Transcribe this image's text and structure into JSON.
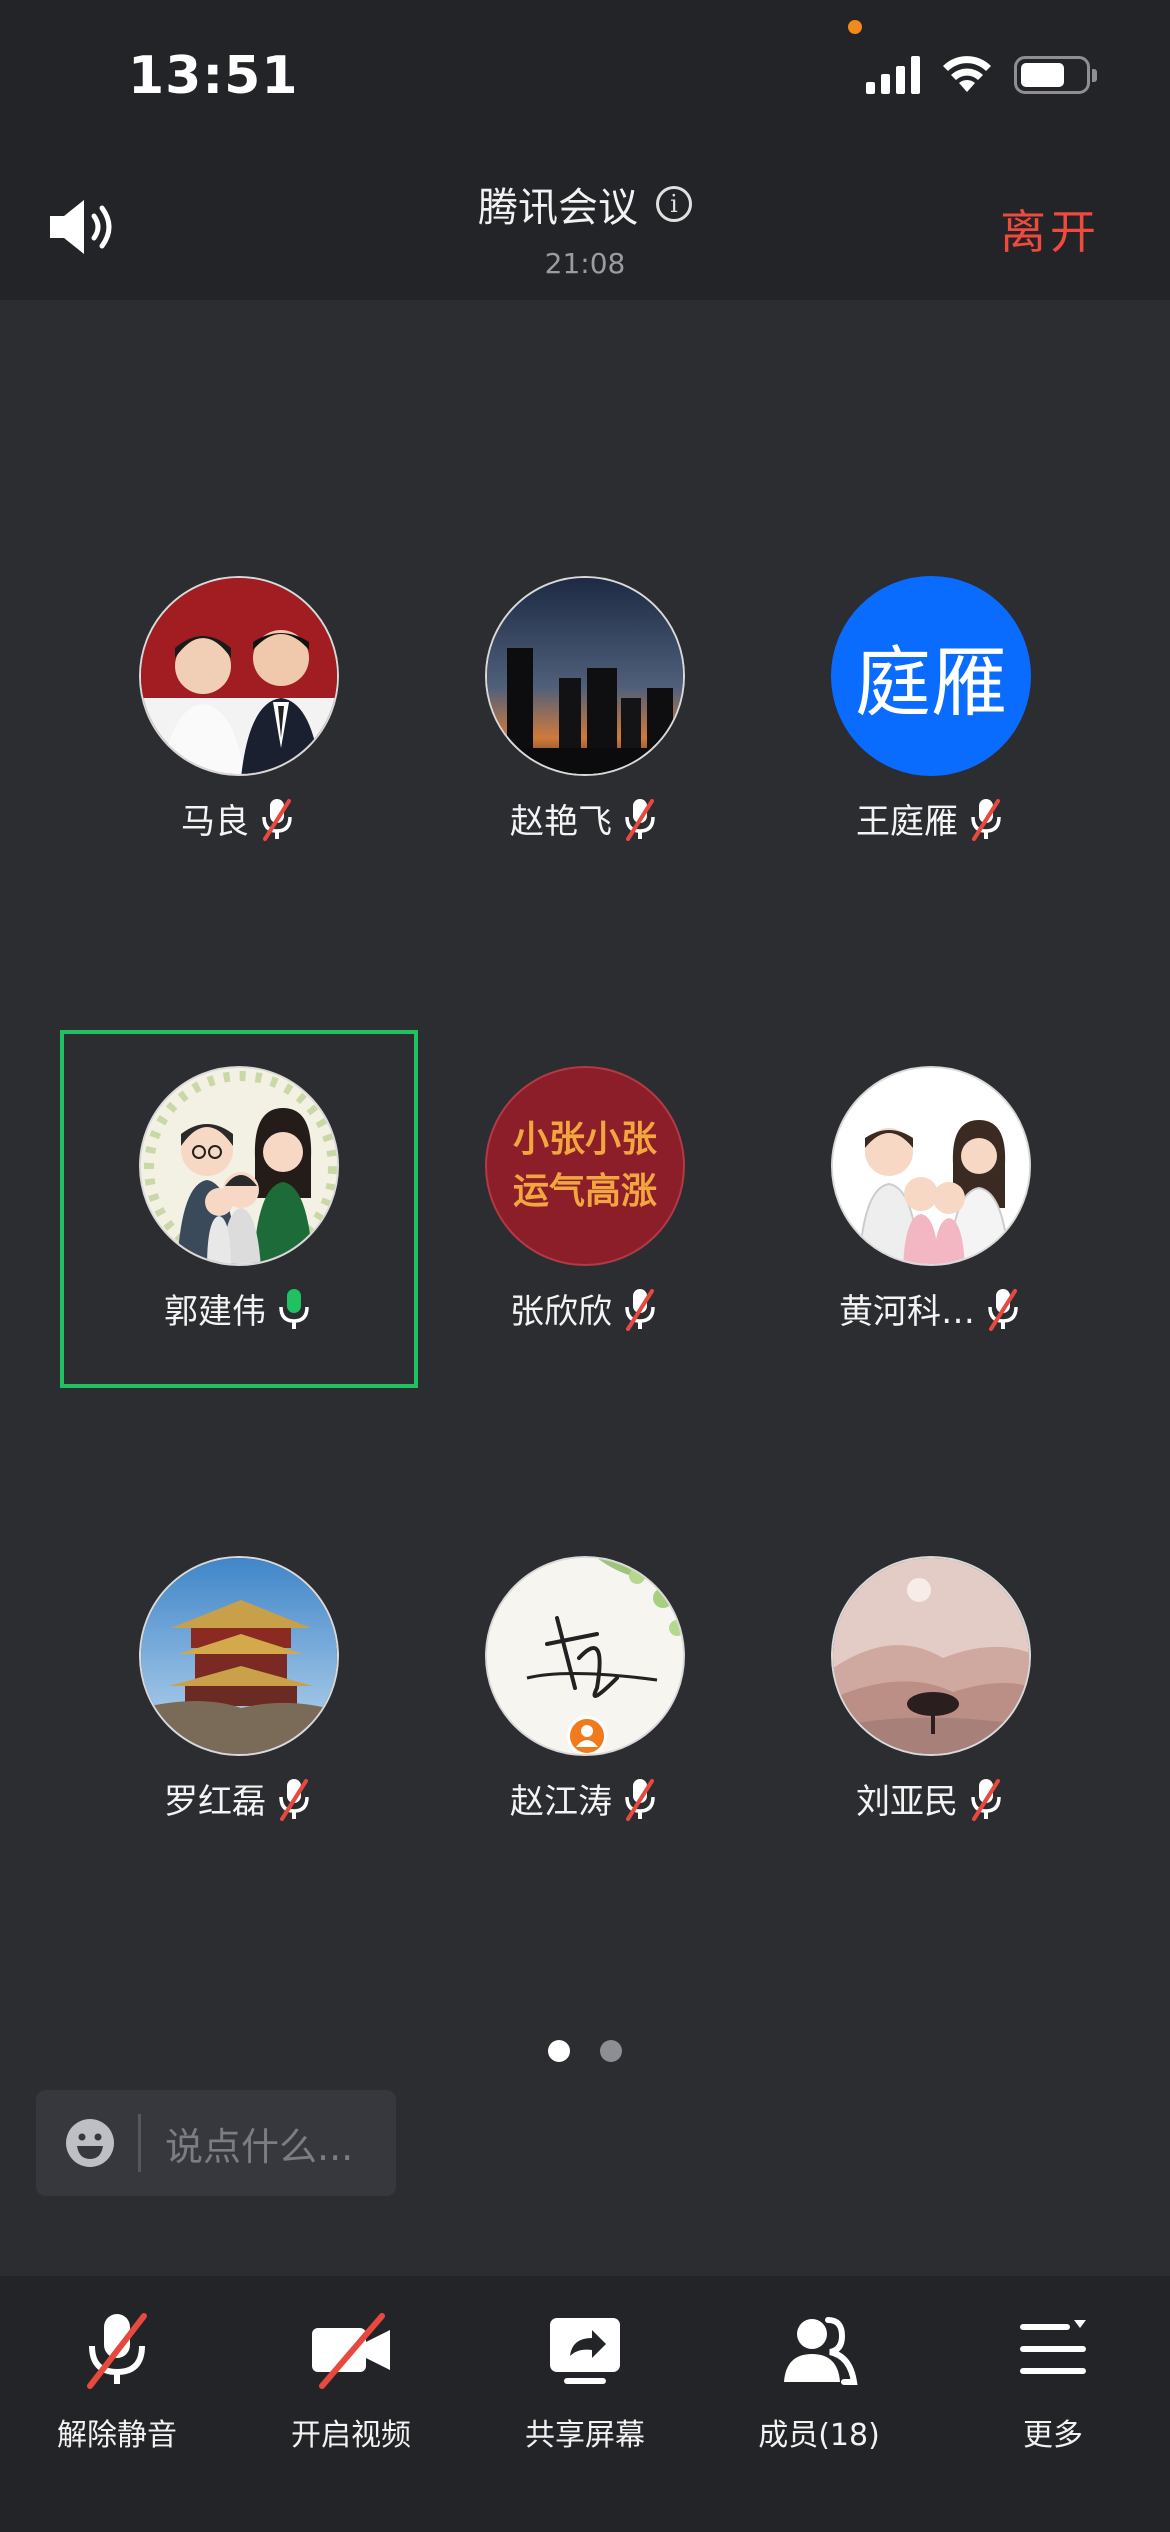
{
  "status": {
    "time": "13:51"
  },
  "header": {
    "title": "腾讯会议",
    "timer": "21:08",
    "leave_label": "离开"
  },
  "participants": [
    {
      "name": "马良",
      "mic": "muted",
      "avatar": "couple-photo"
    },
    {
      "name": "赵艳飞",
      "mic": "muted",
      "avatar": "city-dusk-photo"
    },
    {
      "name": "王庭雁",
      "mic": "muted",
      "avatar": "text-avatar",
      "avatar_text": "庭雁",
      "avatar_color": "#0a6cff"
    },
    {
      "name": "郭建伟",
      "mic": "active",
      "avatar": "family-cartoon",
      "speaking": true
    },
    {
      "name": "张欣欣",
      "mic": "muted",
      "avatar": "red-calligraphy",
      "avatar_text_line1": "小张小张",
      "avatar_text_line2": "运气高涨"
    },
    {
      "name": "黄河科…",
      "mic": "muted",
      "avatar": "family-cartoon-white"
    },
    {
      "name": "罗红磊",
      "mic": "muted",
      "avatar": "pagoda-photo"
    },
    {
      "name": "赵江涛",
      "mic": "muted",
      "avatar": "signature-with-host-badge"
    },
    {
      "name": "刘亚民",
      "mic": "muted",
      "avatar": "pink-landscape"
    }
  ],
  "pager": {
    "pages": 2,
    "current": 1
  },
  "chat": {
    "placeholder": "说点什么..."
  },
  "toolbar": {
    "unmute_label": "解除静音",
    "video_label": "开启视频",
    "share_label": "共享屏幕",
    "members_label": "成员(18)",
    "more_label": "更多"
  },
  "colors": {
    "accent_green": "#1fc160",
    "leave_red": "#f04a3e",
    "muted_red": "#e8493f"
  }
}
